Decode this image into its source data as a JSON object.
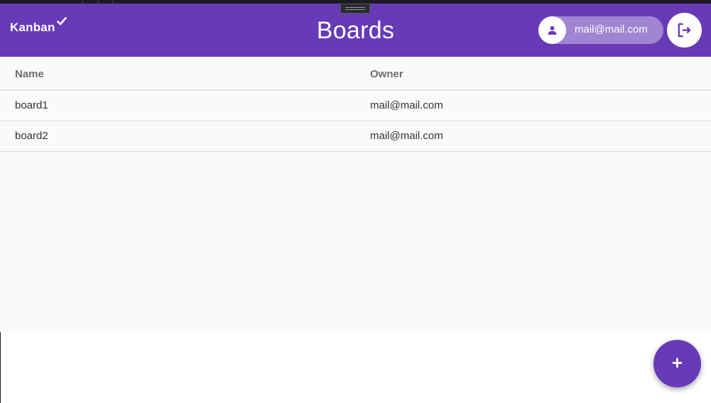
{
  "app": {
    "brand": "Kanban",
    "title": "Boards"
  },
  "user": {
    "email": "mail@mail.com"
  },
  "icons": {
    "brand_check": "check-icon",
    "avatar": "person-icon",
    "logout": "logout-icon",
    "add": "plus-icon"
  },
  "colors": {
    "primary": "#673ab7",
    "panel_bg": "#fafafa"
  },
  "table": {
    "columns": [
      "Name",
      "Owner"
    ],
    "rows": [
      {
        "name": "board1",
        "owner": "mail@mail.com"
      },
      {
        "name": "board2",
        "owner": "mail@mail.com"
      }
    ]
  },
  "fab": {
    "label": "+"
  }
}
